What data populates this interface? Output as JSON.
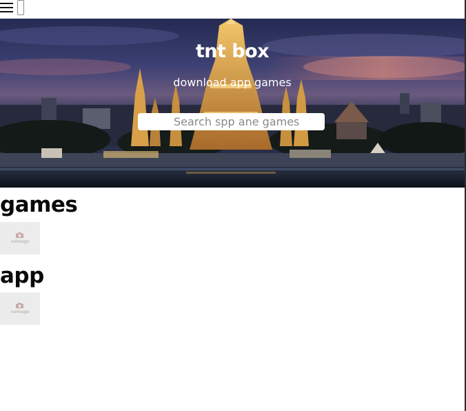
{
  "topbar": {
    "menu_icon": "hamburger-menu-icon",
    "search_field_value": ""
  },
  "hero": {
    "title": "tnt box",
    "subtitle": "download app games",
    "search_placeholder": "Search spp ane games",
    "background": "night-temple-photo"
  },
  "sections": [
    {
      "heading": "games",
      "items": [
        {
          "image_label": "noimage",
          "icon": "camera-icon"
        }
      ]
    },
    {
      "heading": "app",
      "items": [
        {
          "image_label": "noimage",
          "icon": "camera-icon"
        }
      ]
    }
  ],
  "colors": {
    "hero_text": "#ffffff",
    "heading_text": "#0a0a0a",
    "placeholder_bg": "#ececec",
    "placeholder_text": "#b0a3a3"
  }
}
